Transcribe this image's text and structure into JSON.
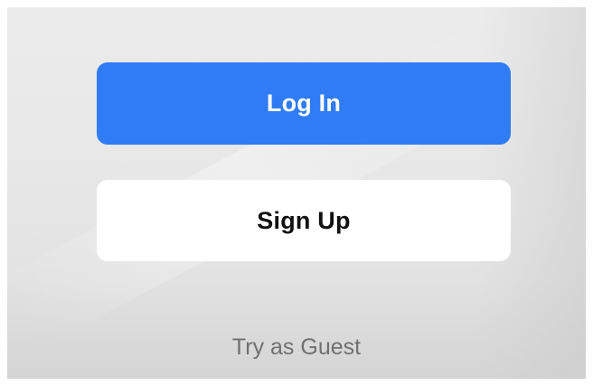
{
  "auth": {
    "login_label": "Log In",
    "signup_label": "Sign Up",
    "guest_label": "Try as Guest"
  },
  "colors": {
    "primary": "#2f7cf6",
    "background": "#e8e8e8",
    "secondary_button": "#ffffff",
    "link_text": "#707070"
  }
}
